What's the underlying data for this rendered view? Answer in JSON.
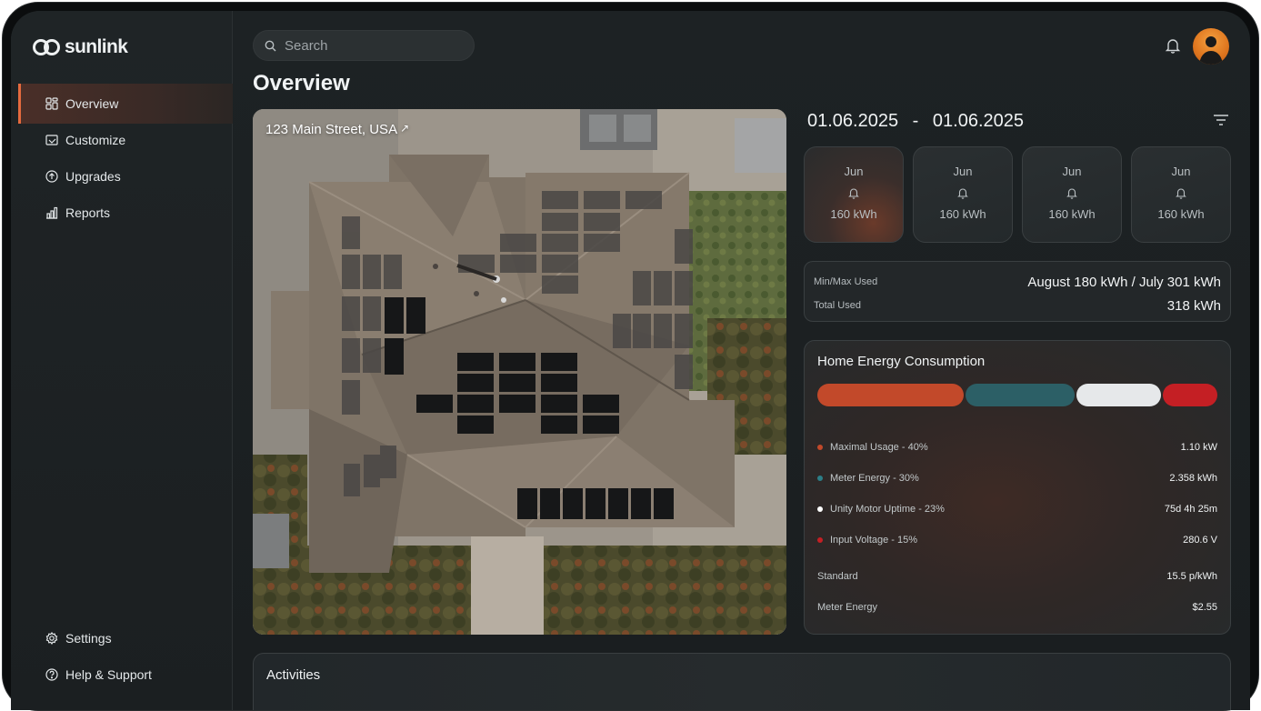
{
  "app": {
    "brand": "sunlink"
  },
  "sidebar": {
    "items": [
      {
        "label": "Overview",
        "icon": "dashboard-icon",
        "active": true
      },
      {
        "label": "Customize",
        "icon": "customize-icon",
        "active": false
      },
      {
        "label": "Upgrades",
        "icon": "upgrade-icon",
        "active": false
      },
      {
        "label": "Reports",
        "icon": "bar-chart-icon",
        "active": false
      }
    ],
    "bottom_items": [
      {
        "label": "Settings",
        "icon": "gear-icon"
      },
      {
        "label": "Help & Support",
        "icon": "help-icon"
      }
    ]
  },
  "header": {
    "search_placeholder": "Search",
    "page_title": "Overview"
  },
  "property": {
    "address": "123 Main Street, USA",
    "link_icon": "↗"
  },
  "date_range": {
    "start": "01.06.2025",
    "separator": "-",
    "end": "01.06.2025"
  },
  "months": [
    {
      "month": "Jun",
      "value": "160 kWh",
      "active": true
    },
    {
      "month": "Jun",
      "value": "160 kWh",
      "active": false
    },
    {
      "month": "Jun",
      "value": "160 kWh",
      "active": false
    },
    {
      "month": "Jun",
      "value": "160 kWh",
      "active": false
    }
  ],
  "stats": {
    "min_max_label": "Min/Max Used",
    "min_max_value": "August 180 kWh / July 301 kWh",
    "total_label": "Total Used",
    "total_value": "318 kWh"
  },
  "energy": {
    "title": "Home Energy Consumption",
    "segments": [
      {
        "name": "Maximal Usage",
        "percent": 40,
        "color": "#c2492a"
      },
      {
        "name": "Meter Energy",
        "percent": 30,
        "color": "#2c5f66"
      },
      {
        "name": "Unity Motor Uptime",
        "percent": 23,
        "color": "#e6e8ea"
      },
      {
        "name": "Input Voltage",
        "percent": 15,
        "color": "#c41f24"
      }
    ],
    "legend": [
      {
        "label": "Maximal Usage - 40%",
        "value": "1.10 kW",
        "color": "#c2492a"
      },
      {
        "label": "Meter Energy - 30%",
        "value": "2.358 kWh",
        "color": "#2c7f88"
      },
      {
        "label": "Unity Motor Uptime - 23%",
        "value": "75d 4h 25m",
        "color": "#ffffff"
      },
      {
        "label": "Input Voltage - 15%",
        "value": "280.6 V",
        "color": "#c41f24"
      }
    ],
    "extra": [
      {
        "label": "Standard",
        "value": "15.5 p/kWh"
      },
      {
        "label": "Meter Energy",
        "value": "$2.55"
      }
    ]
  },
  "activities": {
    "title": "Activities"
  }
}
